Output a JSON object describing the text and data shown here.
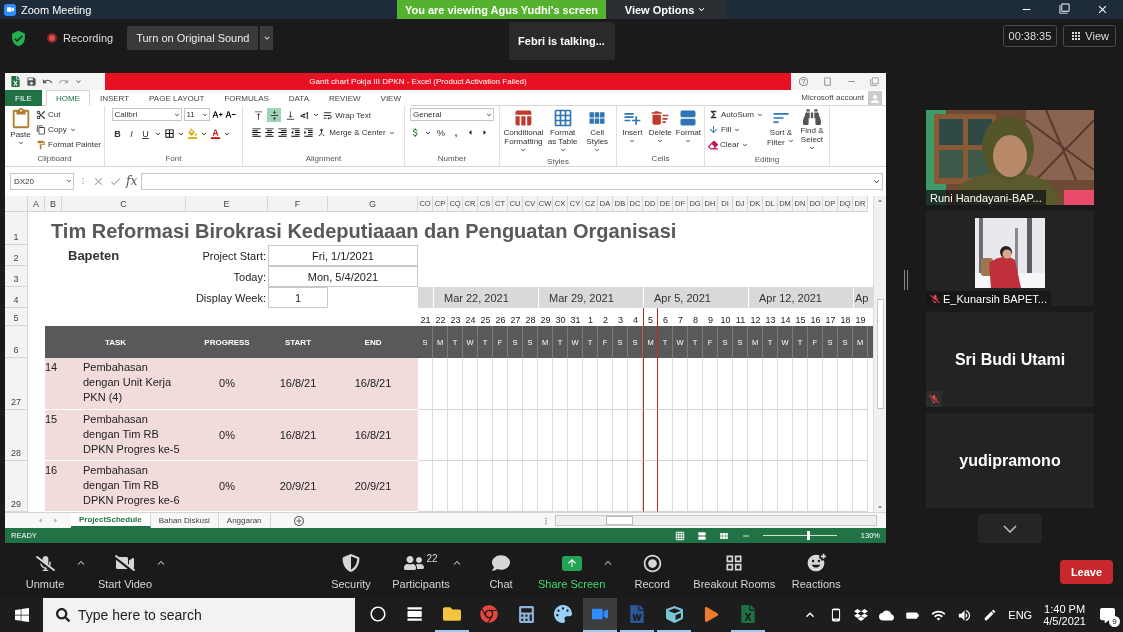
{
  "window": {
    "title": "Zoom Meeting"
  },
  "share_banner": {
    "text": "You are viewing Agus Yudhi's screen",
    "options": "View Options"
  },
  "meeting_bar": {
    "recording": "Recording",
    "original_sound": "Turn on Original Sound",
    "speaker": "Febri is talking...",
    "timer": "00:38:35",
    "view": "View"
  },
  "excel": {
    "title": "Gantt chart Pokja III DPKN -  Excel (Product Activation Failed)",
    "tabs": [
      {
        "label": "FILE",
        "kind": "file",
        "selected": false
      },
      {
        "label": "HOME",
        "kind": "tab",
        "selected": true
      },
      {
        "label": "INSERT",
        "kind": "tab",
        "selected": false
      },
      {
        "label": "PAGE LAYOUT",
        "kind": "tab",
        "selected": false
      },
      {
        "label": "FORMULAS",
        "kind": "tab",
        "selected": false
      },
      {
        "label": "DATA",
        "kind": "tab",
        "selected": false
      },
      {
        "label": "REVIEW",
        "kind": "tab",
        "selected": false
      },
      {
        "label": "VIEW",
        "kind": "tab",
        "selected": false
      }
    ],
    "account": "Microsoft account",
    "ribbon": {
      "clipboard": {
        "label": "Clipboard",
        "paste": "Paste",
        "cut": "Cut",
        "copy": "Copy",
        "format_painter": "Format Painter"
      },
      "font": {
        "label": "Font",
        "name": "Calibri",
        "size": "11",
        "bold": "B",
        "italic": "I",
        "underline": "U"
      },
      "alignment": {
        "label": "Alignment",
        "wrap": "Wrap Text",
        "merge": "Merge & Center",
        "vertical": [
          {
            "selected": false
          },
          {
            "selected": true
          },
          {
            "selected": false
          }
        ]
      },
      "number": {
        "label": "Number",
        "format": "General",
        "percent": "%",
        "comma": ","
      },
      "styles": {
        "label": "Styles",
        "buttons": [
          "Conditional Formatting",
          "Format as Table",
          "Cell Styles"
        ]
      },
      "cells": {
        "label": "Cells",
        "buttons": [
          "Insert",
          "Delete",
          "Format"
        ]
      },
      "editing": {
        "label": "Editing",
        "autosum": "AutoSum",
        "fill": "Fill",
        "clear": "Clear",
        "sort": "Sort & Filter",
        "find": "Find & Select"
      }
    },
    "formula_bar": {
      "name_box": "DX20",
      "fx": "fx"
    },
    "sheet": {
      "columns": [
        "A",
        "B",
        "C",
        "E",
        "F",
        "G"
      ],
      "gantt_columns": [
        "CO",
        "CP",
        "CQ",
        "CR",
        "CS",
        "CT",
        "CU",
        "CV",
        "CW",
        "CX",
        "CY",
        "CZ",
        "DA",
        "DB",
        "DC",
        "DD",
        "DE",
        "DF",
        "DG",
        "DH",
        "DI",
        "DJ",
        "DK",
        "DL",
        "DM",
        "DN",
        "DO",
        "DP",
        "DQ",
        "DR"
      ],
      "row_numbers": [
        "1",
        "2",
        "3",
        "4",
        "5",
        "6"
      ],
      "title": "Tim Reformasi Birokrasi Kedeputiaaan dan Penguatan Organisasi",
      "company": "Bapeten",
      "fields": [
        {
          "label": "Project Start:",
          "value": "Fri, 1/1/2021"
        },
        {
          "label": "Today:",
          "value": "Mon, 5/4/2021"
        },
        {
          "label": "Display Week:",
          "value": "1"
        }
      ],
      "weeks": [
        "Mar 22, 2021",
        "Mar 29, 2021",
        "Apr 5, 2021",
        "Apr 12, 2021",
        "Ap"
      ],
      "days": [
        {
          "date": "21",
          "weekday": "S",
          "today": false
        },
        {
          "date": "22",
          "weekday": "M",
          "today": false
        },
        {
          "date": "23",
          "weekday": "T",
          "today": false
        },
        {
          "date": "24",
          "weekday": "W",
          "today": false
        },
        {
          "date": "25",
          "weekday": "T",
          "today": false
        },
        {
          "date": "26",
          "weekday": "F",
          "today": false
        },
        {
          "date": "27",
          "weekday": "S",
          "today": false
        },
        {
          "date": "28",
          "weekday": "S",
          "today": false
        },
        {
          "date": "29",
          "weekday": "M",
          "today": false
        },
        {
          "date": "30",
          "weekday": "T",
          "today": false
        },
        {
          "date": "31",
          "weekday": "W",
          "today": false
        },
        {
          "date": "1",
          "weekday": "T",
          "today": false
        },
        {
          "date": "2",
          "weekday": "F",
          "today": false
        },
        {
          "date": "3",
          "weekday": "S",
          "today": false
        },
        {
          "date": "4",
          "weekday": "S",
          "today": false
        },
        {
          "date": "5",
          "weekday": "M",
          "today": true
        },
        {
          "date": "6",
          "weekday": "T",
          "today": false
        },
        {
          "date": "7",
          "weekday": "W",
          "today": false
        },
        {
          "date": "8",
          "weekday": "T",
          "today": false
        },
        {
          "date": "9",
          "weekday": "F",
          "today": false
        },
        {
          "date": "10",
          "weekday": "S",
          "today": false
        },
        {
          "date": "11",
          "weekday": "S",
          "today": false
        },
        {
          "date": "12",
          "weekday": "M",
          "today": false
        },
        {
          "date": "13",
          "weekday": "T",
          "today": false
        },
        {
          "date": "14",
          "weekday": "W",
          "today": false
        },
        {
          "date": "15",
          "weekday": "T",
          "today": false
        },
        {
          "date": "16",
          "weekday": "F",
          "today": false
        },
        {
          "date": "17",
          "weekday": "S",
          "today": false
        },
        {
          "date": "18",
          "weekday": "S",
          "today": false
        },
        {
          "date": "19",
          "weekday": "M",
          "today": false
        }
      ],
      "headers": [
        "TASK",
        "PROGRESS",
        "START",
        "END"
      ],
      "tasks": [
        {
          "row": "27",
          "number": "14",
          "task": "Pembahasan\ndengan Unit Kerja\nPKN (4)",
          "progress": "0%",
          "start": "16/8/21",
          "end": "16/8/21"
        },
        {
          "row": "28",
          "number": "15",
          "task": "Pembahasan\ndengan Tim RB\nDPKN Progres ke-5",
          "progress": "0%",
          "start": "16/8/21",
          "end": "16/8/21"
        },
        {
          "row": "29",
          "number": "16",
          "task": "Pembahasan\ndengan Tim RB\nDPKN Progres ke-6",
          "progress": "0%",
          "start": "20/9/21",
          "end": "20/9/21"
        }
      ]
    },
    "sheet_tabs": [
      {
        "label": "ProjectSchedule",
        "selected": true
      },
      {
        "label": "Bahan Diskusi",
        "selected": false
      },
      {
        "label": "Anggaran",
        "selected": false
      }
    ],
    "status": {
      "text": "READY",
      "zoom": "130%",
      "zoom_slider": {
        "level": 0.6
      }
    }
  },
  "participants": [
    {
      "name": "Runi Handayani-BAP...",
      "kind": "video",
      "muted": false
    },
    {
      "name": "E_Kunarsih BAPET...",
      "kind": "avatar",
      "muted": true
    },
    {
      "name": "Sri Budi Utami",
      "kind": "name",
      "muted": true
    },
    {
      "name": "yudipramono",
      "kind": "name",
      "muted": false
    }
  ],
  "toolbar": [
    {
      "kind": "mic",
      "label": "Unmute",
      "caret": true
    },
    {
      "kind": "video",
      "label": "Start Video",
      "caret": true
    },
    {
      "kind": "security",
      "label": "Security",
      "caret": false
    },
    {
      "kind": "participants",
      "label": "Participants",
      "count": "22",
      "caret": true
    },
    {
      "kind": "chat",
      "label": "Chat",
      "caret": false
    },
    {
      "kind": "share",
      "label": "Share Screen",
      "caret": true
    },
    {
      "kind": "record",
      "label": "Record",
      "caret": false
    },
    {
      "kind": "breakout",
      "label": "Breakout Rooms",
      "caret": false
    },
    {
      "kind": "reactions",
      "label": "Reactions",
      "caret": false
    }
  ],
  "leave": "Leave",
  "taskbar": {
    "search_placeholder": "Type here to search",
    "apps": [
      {
        "kind": "cortana",
        "running": false,
        "active": false
      },
      {
        "kind": "taskview",
        "running": false,
        "active": false
      },
      {
        "kind": "folder",
        "running": true,
        "active": false
      },
      {
        "kind": "browser",
        "running": false,
        "active": false
      },
      {
        "kind": "calculator",
        "running": false,
        "active": false
      },
      {
        "kind": "paint",
        "running": false,
        "active": false
      },
      {
        "kind": "camera",
        "running": true,
        "active": true
      },
      {
        "kind": "document",
        "running": true,
        "active": false
      },
      {
        "kind": "cube",
        "running": true,
        "active": false
      },
      {
        "kind": "media",
        "running": false,
        "active": false
      },
      {
        "kind": "spreadsheet",
        "running": true,
        "active": false
      }
    ],
    "language": "ENG",
    "time": "1:40 PM",
    "date": "4/5/2021",
    "notifications": "9"
  }
}
